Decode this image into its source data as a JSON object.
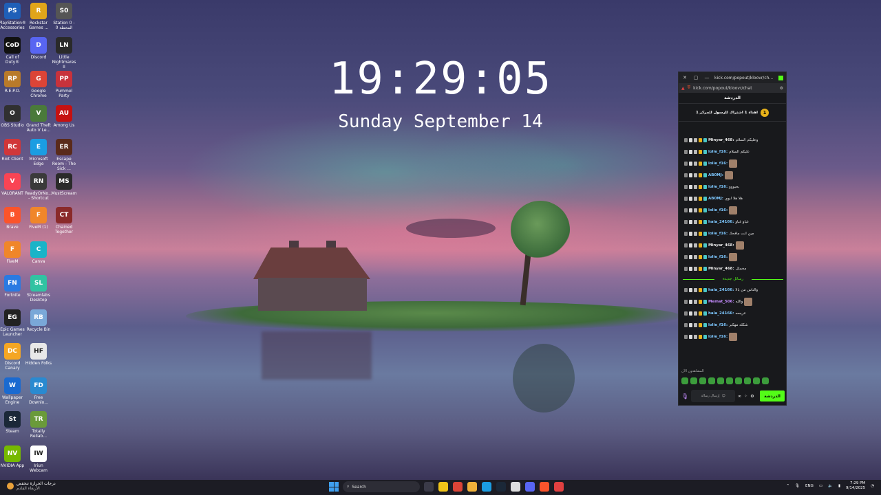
{
  "clock": {
    "time": "19:29:05",
    "date": "Sunday September 14"
  },
  "desktop_icons": [
    {
      "label": "PlayStation® Accessories",
      "color": "#1f5fb8",
      "glyph": "PS"
    },
    {
      "label": "Rockstar Games ...",
      "color": "#e0a51a",
      "glyph": "R"
    },
    {
      "label": "Station 0 - المحطة 0",
      "color": "#555555",
      "glyph": "S0"
    },
    {
      "label": "Call of Duty®",
      "color": "#111111",
      "glyph": "CoD"
    },
    {
      "label": "Discord",
      "color": "#5865f2",
      "glyph": "D"
    },
    {
      "label": "Little Nightmares II",
      "color": "#2a2a2a",
      "glyph": "LN"
    },
    {
      "label": "R.E.P.O.",
      "color": "#b87a2a",
      "glyph": "RP"
    },
    {
      "label": "Google Chrome",
      "color": "#db4437",
      "glyph": "G"
    },
    {
      "label": "Pummel Party",
      "color": "#c8323c",
      "glyph": "PP"
    },
    {
      "label": "OBS Studio",
      "color": "#303030",
      "glyph": "O"
    },
    {
      "label": "Grand Theft Auto V Le...",
      "color": "#4a7a3a",
      "glyph": "V"
    },
    {
      "label": "Among Us",
      "color": "#c51111",
      "glyph": "AU"
    },
    {
      "label": "Riot Client",
      "color": "#d13639",
      "glyph": "RC"
    },
    {
      "label": "Microsoft Edge",
      "color": "#1b9de2",
      "glyph": "E"
    },
    {
      "label": "Escape Room - The Sick ...",
      "color": "#5a2a1a",
      "glyph": "ER"
    },
    {
      "label": "VALORANT",
      "color": "#fa4454",
      "glyph": "V"
    },
    {
      "label": "ReadyOrNo... - Shortcut",
      "color": "#3a3a3a",
      "glyph": "RN"
    },
    {
      "label": "MustScream",
      "color": "#2a2a2a",
      "glyph": "MS"
    },
    {
      "label": "Brave",
      "color": "#fb542b",
      "glyph": "B"
    },
    {
      "label": "FiveM (1)",
      "color": "#f0862a",
      "glyph": "F"
    },
    {
      "label": "Chained Together",
      "color": "#8a2a2a",
      "glyph": "CT"
    },
    {
      "label": "FiveM",
      "color": "#f0862a",
      "glyph": "F"
    },
    {
      "label": "Canva",
      "color": "#19b4c8",
      "glyph": "C"
    },
    {
      "label": "Fortnite",
      "color": "#2a7ae2",
      "glyph": "FN"
    },
    {
      "label": "Streamlabs Desktop",
      "color": "#31c3a2",
      "glyph": "SL"
    },
    {
      "label": "Epic Games Launcher",
      "color": "#222222",
      "glyph": "EG"
    },
    {
      "label": "Recycle Bin",
      "color": "#7aa8d8",
      "glyph": "RB"
    },
    {
      "label": "Discord Canary",
      "color": "#f5a623",
      "glyph": "DC"
    },
    {
      "label": "Hidden Folks",
      "color": "#e8e8e8",
      "glyph": "HF"
    },
    {
      "label": "Wallpaper Engine",
      "color": "#1a6ad0",
      "glyph": "W"
    },
    {
      "label": "Free Downlo...",
      "color": "#2a8ad0",
      "glyph": "FD"
    },
    {
      "label": "Steam",
      "color": "#1b2838",
      "glyph": "St"
    },
    {
      "label": "Totally Reliab...",
      "color": "#6a9a3a",
      "glyph": "TR"
    },
    {
      "label": "NVIDIA App",
      "color": "#76b900",
      "glyph": "NV"
    },
    {
      "label": "Iriun Webcam",
      "color": "#ffffff",
      "glyph": "IW"
    }
  ],
  "chat": {
    "titlebar_url": "kick.com/popout/kloovr/ch...",
    "address": "kick.com/popout/kloovr/chat",
    "header": "الدردشة",
    "pinned": "اهداء 1 اشتراك للرسول للمركز 1",
    "pinned_badge": "1",
    "new_messages": "رسائل جديدة",
    "watching": "المشاهدون الآن",
    "input_placeholder": "إرسال رسالة",
    "send_label": "الدردشة",
    "messages": [
      {
        "user": "Minyar_468:",
        "text": "وعليكم السلام",
        "color": "#e6e6e6",
        "emote": false
      },
      {
        "user": "lolie_f16:",
        "text": "عليكم السلام",
        "color": "#7ec8ff",
        "emote": false
      },
      {
        "user": "lolie_f16:",
        "text": "",
        "color": "#7ec8ff",
        "emote": true
      },
      {
        "user": "AB0MJ:",
        "text": "",
        "color": "#7ec8ff",
        "emote": true
      },
      {
        "user": "lolie_f16:",
        "text": "بحبووو",
        "color": "#7ec8ff",
        "emote": false
      },
      {
        "user": "AB0MJ:",
        "text": "هلا هلا ابوي",
        "color": "#7ec8ff",
        "emote": false
      },
      {
        "user": "lolie_f16:",
        "text": "",
        "color": "#7ec8ff",
        "emote": true
      },
      {
        "user": "hala_24166:",
        "text": "غباو غباو",
        "color": "#7ec8ff",
        "emote": false
      },
      {
        "user": "lolie_f16:",
        "text": "مين انت مافحك",
        "color": "#7ec8ff",
        "emote": false
      },
      {
        "user": "Minyar_468:",
        "text": "",
        "color": "#e6e6e6",
        "emote": true
      },
      {
        "user": "lolie_f16:",
        "text": "",
        "color": "#7ec8ff",
        "emote": true
      },
      {
        "user": "Minyar_468:",
        "text": "مخملل",
        "color": "#e6e6e6",
        "emote": false
      }
    ],
    "new_list": [
      {
        "user": "hala_24166:",
        "text": "والناس من بالا",
        "color": "#7ec8ff",
        "emote": false
      },
      {
        "user": "Memat_506:",
        "text": "والله",
        "color": "#c58cff",
        "emote": true
      },
      {
        "user": "hala_24166:",
        "text": "عريسه",
        "color": "#7ec8ff",
        "emote": false
      },
      {
        "user": "lolie_f16:",
        "text": "شكله مهكبر",
        "color": "#7ec8ff",
        "emote": false
      },
      {
        "user": "lolie_f16:",
        "text": "",
        "color": "#7ec8ff",
        "emote": true
      }
    ]
  },
  "taskbar": {
    "weather_line1": "درجات الحرارة تنخفض",
    "weather_line2": "الأربعاء القادم",
    "search_placeholder": "Search",
    "lang": "ENG",
    "time": "7:29 PM",
    "date": "9/14/2025",
    "app_colors": [
      "#3a3a48",
      "#f0c419",
      "#db4437",
      "#f0b23a",
      "#1b9de2",
      "#1b2838",
      "#dddddd",
      "#5865f2",
      "#fb542b",
      "#e04040"
    ]
  }
}
